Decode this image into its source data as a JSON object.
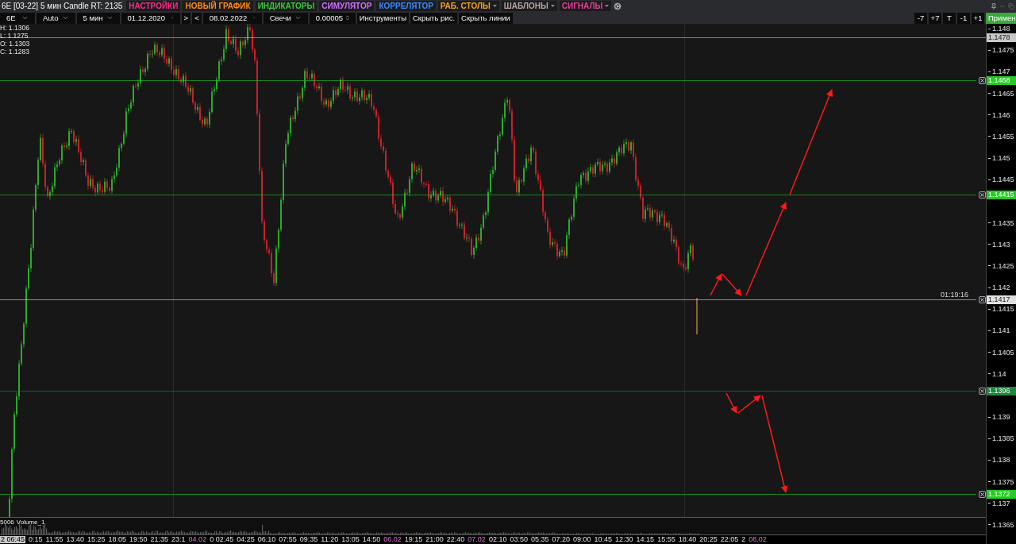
{
  "title": "6E [03-22] 5 мин Candle RT: 2135",
  "menus": [
    {
      "label": "НАСТРОЙКИ",
      "color": "#ff2a8a",
      "has_menu": false
    },
    {
      "label": "НОВЫЙ ГРАФИК",
      "color": "#ff8a1a",
      "has_menu": false
    },
    {
      "label": "ИНДИКАТОРЫ",
      "color": "#3cc83c",
      "has_menu": false
    },
    {
      "label": "СИМУЛЯТОР",
      "color": "#d070ff",
      "has_menu": false
    },
    {
      "label": "КОРРЕЛЯТОР",
      "color": "#3a8aff",
      "has_menu": false
    },
    {
      "label": "РАБ. СТОЛЫ",
      "color": "#f0a020",
      "has_menu": true
    },
    {
      "label": "ШАБЛОНЫ",
      "color": "#b8a4a4",
      "has_menu": true
    },
    {
      "label": "СИГНАЛЫ",
      "color": "#e0409a",
      "has_menu": true
    }
  ],
  "controls": [
    {
      "kind": "select",
      "value": "6E"
    },
    {
      "kind": "select",
      "value": "Auto"
    },
    {
      "kind": "select",
      "value": "5 мин"
    },
    {
      "kind": "date",
      "value": "01.12.2020"
    },
    {
      "kind": "button",
      "value": ">"
    },
    {
      "kind": "button",
      "value": "<"
    },
    {
      "kind": "date",
      "value": "08.02.2022"
    },
    {
      "kind": "select",
      "value": "Свечи"
    },
    {
      "kind": "spinner",
      "value": "0.00005"
    },
    {
      "kind": "button",
      "value": "Инструменты"
    },
    {
      "kind": "button",
      "value": "Скрыть рис."
    },
    {
      "kind": "button",
      "value": "Скрыть линии"
    }
  ],
  "shift_buttons": [
    "-7",
    "+7",
    "T",
    "-1",
    "+1"
  ],
  "apply_button": "Примен",
  "ohlc": [
    "H: 1.1306",
    "L: 1.1275",
    "O: 1.1303",
    "C: 1.1283"
  ],
  "levels": [
    {
      "price": "1.1478",
      "kind": "last",
      "color": "#c8c8c8",
      "removable": false
    },
    {
      "price": "1.1468",
      "kind": "alert",
      "color": "#22cc22",
      "removable": true
    },
    {
      "price": "1.14415",
      "kind": "alert",
      "color": "#22cc22",
      "removable": true
    },
    {
      "price": "1.1417",
      "kind": "current",
      "color": "#e0e0e0",
      "removable": true,
      "timer": "01:19:16"
    },
    {
      "price": "1.1396",
      "kind": "alert",
      "color": "#1a8a3a",
      "removable": true
    },
    {
      "price": "1.1372",
      "kind": "alert",
      "color": "#22cc22",
      "removable": true
    }
  ],
  "price_ticks": [
    "1.148",
    "1.1475",
    "1.147",
    "1.1465",
    "1.146",
    "1.1455",
    "1.145",
    "1.1445",
    "1.1435",
    "1.143",
    "1.1425",
    "1.142",
    "1.1415",
    "1.141",
    "1.1405",
    "1.14",
    "1.139",
    "1.1385",
    "1.138",
    "1.1375",
    "1.137",
    "1.1365"
  ],
  "volume_panel": {
    "value": "5006",
    "name": "Volume_1"
  },
  "time_labels": [
    {
      "text": "2 06:45",
      "kind": "cursor"
    },
    {
      "text": "0:15",
      "kind": "time"
    },
    {
      "text": "11:55",
      "kind": "time"
    },
    {
      "text": "13:40",
      "kind": "time"
    },
    {
      "text": "15:25",
      "kind": "time"
    },
    {
      "text": "18:05",
      "kind": "time"
    },
    {
      "text": "19:50",
      "kind": "time"
    },
    {
      "text": "21:35",
      "kind": "time"
    },
    {
      "text": "23:1",
      "kind": "time"
    },
    {
      "text": "04.02",
      "kind": "date"
    },
    {
      "text": "0 02:45",
      "kind": "time"
    },
    {
      "text": "04:25",
      "kind": "time"
    },
    {
      "text": "06:10",
      "kind": "time"
    },
    {
      "text": "07:55",
      "kind": "time"
    },
    {
      "text": "09:35",
      "kind": "time"
    },
    {
      "text": "11:20",
      "kind": "time"
    },
    {
      "text": "13:05",
      "kind": "time"
    },
    {
      "text": "14:50",
      "kind": "time"
    },
    {
      "text": "06.02",
      "kind": "date"
    },
    {
      "text": "19:15",
      "kind": "time"
    },
    {
      "text": "21:00",
      "kind": "time"
    },
    {
      "text": "22:40",
      "kind": "time"
    },
    {
      "text": "07.02",
      "kind": "date"
    },
    {
      "text": "02:10",
      "kind": "time"
    },
    {
      "text": "03:50",
      "kind": "time"
    },
    {
      "text": "05:35",
      "kind": "time"
    },
    {
      "text": "07:20",
      "kind": "time"
    },
    {
      "text": "09:00",
      "kind": "time"
    },
    {
      "text": "10:45",
      "kind": "time"
    },
    {
      "text": "12:30",
      "kind": "time"
    },
    {
      "text": "14:15",
      "kind": "time"
    },
    {
      "text": "15:55",
      "kind": "time"
    },
    {
      "text": "18:40",
      "kind": "time"
    },
    {
      "text": "20:25",
      "kind": "time"
    },
    {
      "text": "22:05",
      "kind": "time"
    },
    {
      "text": "2",
      "kind": "time"
    },
    {
      "text": "08.02",
      "kind": "date"
    }
  ]
}
